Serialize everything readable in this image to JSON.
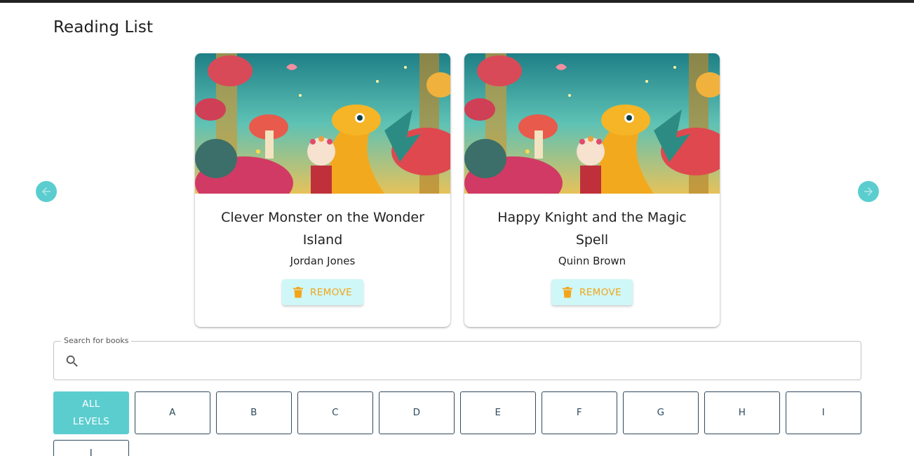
{
  "page": {
    "title": "Reading List"
  },
  "colors": {
    "accent": "#5bcdcf",
    "remove_text": "#f3a51a",
    "remove_bg": "#cff7f7",
    "level_border": "#2e4a5e"
  },
  "carousel": {
    "prev_icon": "arrow-left-icon",
    "next_icon": "arrow-right-icon"
  },
  "books": [
    {
      "title": "Clever Monster on the Wonder Island",
      "author": "Jordan Jones",
      "remove_label": "REMOVE",
      "image": "fantasy-forest-dragon-girl-illustration"
    },
    {
      "title": "Happy Knight and the Magic Spell",
      "author": "Quinn Brown",
      "remove_label": "REMOVE",
      "image": "fantasy-forest-dragon-girl-illustration"
    }
  ],
  "search": {
    "legend": "Search for books",
    "value": "",
    "placeholder": "",
    "icon": "search-icon"
  },
  "levels": {
    "selected": "ALL LEVELS",
    "items": [
      "ALL\nLEVELS",
      "A",
      "B",
      "C",
      "D",
      "E",
      "F",
      "G",
      "H",
      "I",
      "J"
    ]
  }
}
